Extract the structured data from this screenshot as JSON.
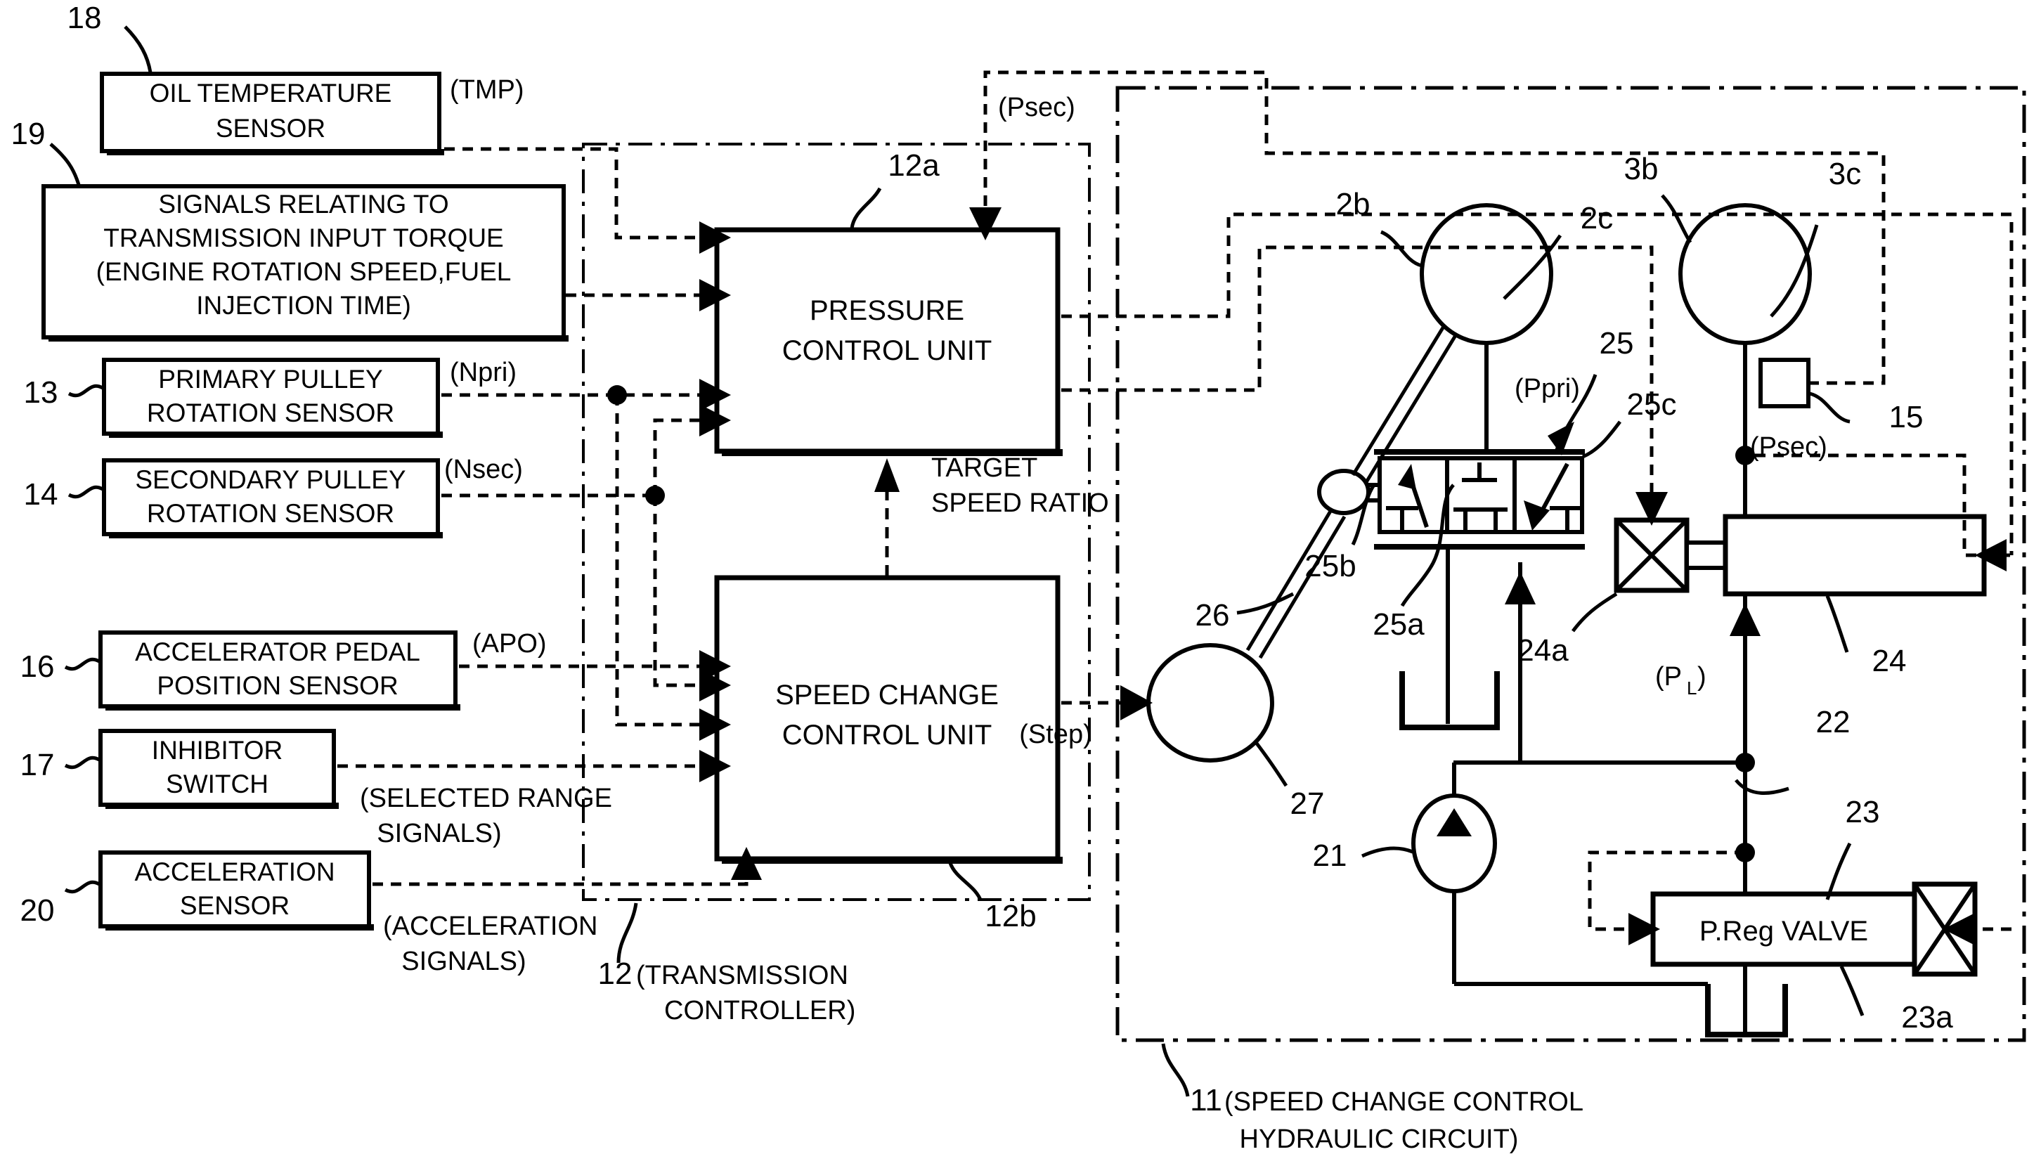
{
  "figure": {
    "title": "CVT speed change control block diagram",
    "sensor_blocks": [
      {
        "ref": "18",
        "label_line1": "OIL TEMPERATURE",
        "label_line2": "SENSOR",
        "signal": "(TMP)"
      },
      {
        "ref": "19",
        "label_line1": "SIGNALS RELATING TO",
        "label_line2": "TRANSMISSION INPUT TORQUE",
        "label_line3": "(ENGINE ROTATION SPEED,FUEL",
        "label_line4": "INJECTION TIME)",
        "signal": ""
      },
      {
        "ref": "13",
        "label_line1": "PRIMARY PULLEY",
        "label_line2": "ROTATION SENSOR",
        "signal": "(Npri)"
      },
      {
        "ref": "14",
        "label_line1": "SECONDARY PULLEY",
        "label_line2": "ROTATION SENSOR",
        "signal": "(Nsec)"
      },
      {
        "ref": "16",
        "label_line1": "ACCELERATOR PEDAL",
        "label_line2": "POSITION SENSOR",
        "signal": "(APO)"
      },
      {
        "ref": "17",
        "label_line1": "INHIBITOR",
        "label_line2": "SWITCH",
        "signal": "(SELECTED RANGE",
        "signal2": "SIGNALS)"
      },
      {
        "ref": "20",
        "label_line1": "ACCELERATION",
        "label_line2": "SENSOR",
        "signal": "(ACCELERATION",
        "signal2": "SIGNALS)"
      }
    ],
    "controller": {
      "ref": "12",
      "caption_line1": "(TRANSMISSION",
      "caption_line2": "CONTROLLER)",
      "units": [
        {
          "ref": "12a",
          "line1": "PRESSURE",
          "line2": "CONTROL UNIT"
        },
        {
          "ref": "12b",
          "line1": "SPEED CHANGE",
          "line2": "CONTROL UNIT"
        }
      ],
      "internal_signal_line1": "TARGET",
      "internal_signal_line2": "SPEED RATIO",
      "output_signal": "(Step)"
    },
    "hydraulic_circuit": {
      "ref": "11",
      "caption_line1": "(SPEED CHANGE CONTROL",
      "caption_line2": "HYDRAULIC CIRCUIT)",
      "components": [
        {
          "ref": "2b",
          "kind": "primary-pulley-cylinder"
        },
        {
          "ref": "2c",
          "kind": "primary-pulley-chamber"
        },
        {
          "ref": "3b",
          "kind": "secondary-pulley-cylinder"
        },
        {
          "ref": "3c",
          "kind": "secondary-pulley-chamber"
        },
        {
          "ref": "15",
          "kind": "secondary-pressure-sensor"
        },
        {
          "ref": "21",
          "kind": "oil-pump"
        },
        {
          "ref": "22",
          "kind": "line-pressure-passage"
        },
        {
          "ref": "23",
          "kind": "pressure-regulating-valve",
          "label": "P.Reg VALVE"
        },
        {
          "ref": "23a",
          "kind": "p-reg-solenoid"
        },
        {
          "ref": "24",
          "kind": "secondary-pressure-valve"
        },
        {
          "ref": "24a",
          "kind": "secondary-pressure-solenoid"
        },
        {
          "ref": "25",
          "kind": "speed-change-control-valve"
        },
        {
          "ref": "25a",
          "kind": "spool"
        },
        {
          "ref": "25b",
          "kind": "link-joint"
        },
        {
          "ref": "25c",
          "kind": "valve-body"
        },
        {
          "ref": "26",
          "kind": "servo-link"
        },
        {
          "ref": "27",
          "kind": "step-motor"
        }
      ],
      "pressure_labels": [
        {
          "text": "(Ppri)",
          "desc": "primary pressure"
        },
        {
          "text": "(Psec)",
          "desc": "secondary pressure feedback top"
        },
        {
          "text": "(Psec)",
          "desc": "secondary pressure sensor output"
        },
        {
          "text": "(P",
          "sub": "L",
          "close": ")",
          "desc": "line pressure"
        }
      ]
    }
  }
}
